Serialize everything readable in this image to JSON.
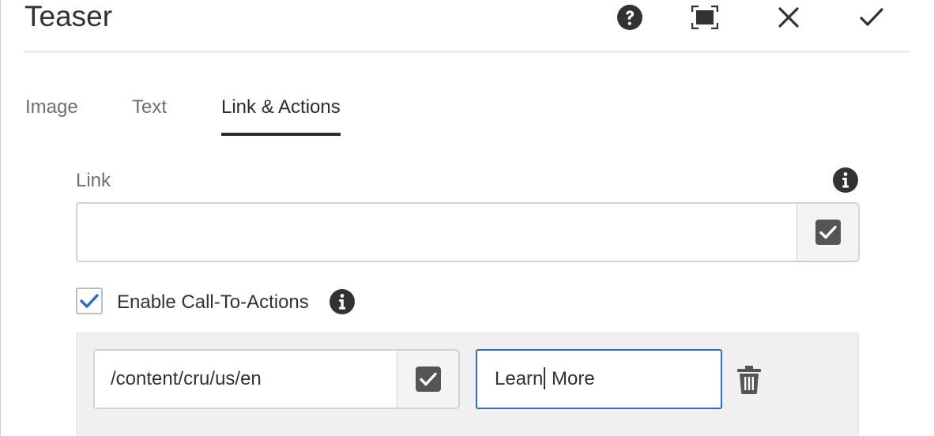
{
  "dialog": {
    "title": "Teaser"
  },
  "header_actions": {
    "help_icon": "help-icon",
    "fullscreen_icon": "fullscreen-icon",
    "close_icon": "close-icon",
    "done_icon": "checkmark-icon"
  },
  "tabs": [
    {
      "label": "Image",
      "active": false
    },
    {
      "label": "Text",
      "active": false
    },
    {
      "label": "Link & Actions",
      "active": true
    }
  ],
  "link": {
    "label": "Link",
    "value": "",
    "placeholder": ""
  },
  "cta": {
    "checkbox_label": "Enable Call-To-Actions",
    "checked": true,
    "items": [
      {
        "link": "/content/cru/us/en",
        "text_before_caret": "Learn",
        "text_after_caret": " More"
      }
    ]
  },
  "colors": {
    "accent": "#2d6ccf",
    "icon_dark": "#323232",
    "tab_underline": "#2c2c2c",
    "panel_bg": "#f0f0f0"
  }
}
